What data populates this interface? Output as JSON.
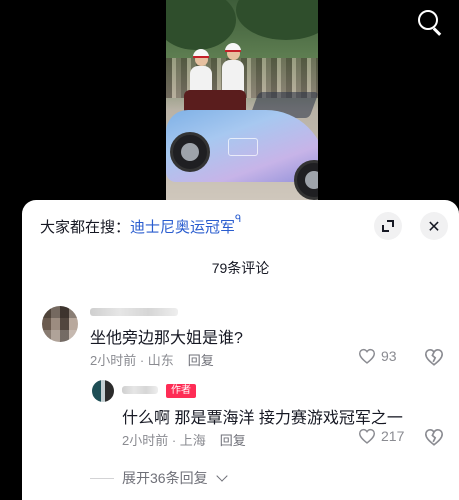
{
  "video": {
    "icons": {
      "search": "search-icon"
    }
  },
  "comments_panel": {
    "search_prefix": "大家都在搜：",
    "search_link": "迪士尼奥运冠军",
    "search_link_icon": "ᑫ",
    "close_glyph": "✕",
    "count_label": "79条评论",
    "comments": [
      {
        "text": "坐他旁边那大姐是谁?",
        "time_location": "2小时前 · 山东",
        "reply_label": "回复",
        "likes": "93"
      }
    ],
    "reply": {
      "badge": "作者",
      "text": "什么啊 那是覃海洋 接力赛游戏冠军之一",
      "time_location": "2小时前 · 上海",
      "reply_label": "回复",
      "likes": "217"
    },
    "expand_label": "展开36条回复"
  },
  "colors": {
    "link": "#2a5dcf",
    "author_badge": "#fe2c55",
    "meta_text": "#8a8b91"
  }
}
